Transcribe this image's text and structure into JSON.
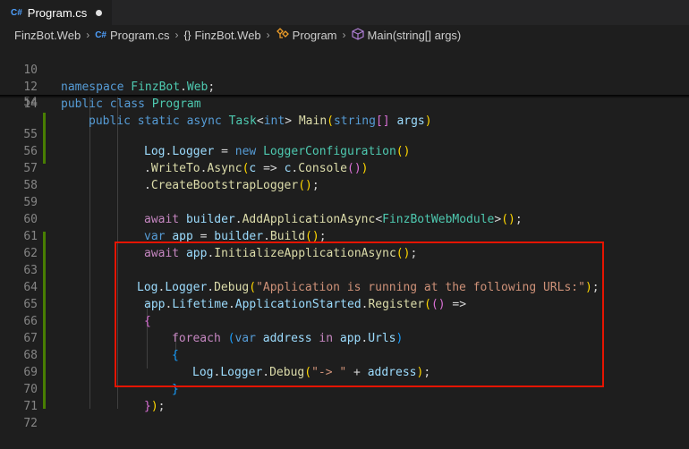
{
  "tab": {
    "badge": "C#",
    "label": "Program.cs"
  },
  "breadcrumb": {
    "project": "FinzBot.Web",
    "file_badge": "C#",
    "file": "Program.cs",
    "ns_icon": "{}",
    "namespace": "FinzBot.Web",
    "class": "Program",
    "method": "Main(string[] args)"
  },
  "icons": {
    "class_icon": "class-symbol-icon",
    "method_icon": "method-cube-icon",
    "chevron": "›"
  },
  "lines": {
    "l10": {
      "n": "10",
      "a": "namespace",
      "b": " FinzBot",
      "c": ".",
      "d": "Web",
      "e": ";"
    },
    "l12": {
      "n": "12",
      "a": "public",
      "b": " ",
      "c": "class",
      "d": " ",
      "e": "Program"
    },
    "l14": {
      "n": "14",
      "a": "public",
      "b": " ",
      "c": "static",
      "d": " ",
      "e": "async",
      "f": " ",
      "g": "Task",
      "h": "<",
      "i": "int",
      "j": ">",
      "k": " ",
      "l": "Main",
      "m": "(",
      "o": "string",
      "p": "[]",
      "q": " ",
      "r": "args",
      "s": ")"
    },
    "l54": {
      "n": "54"
    },
    "l55": {
      "n": "55",
      "a": "Log",
      "b": ".",
      "c": "Logger",
      "d": " = ",
      "e": "new",
      "f": " ",
      "g": "LoggerConfiguration",
      "h": "()"
    },
    "l56": {
      "n": "56",
      "a": ".",
      "b": "WriteTo",
      "c": ".",
      "d": "Async",
      "e": "(",
      "f": "c",
      "g": " => ",
      "h": "c",
      "i": ".",
      "j": "Console",
      "k": "()",
      "l": ")"
    },
    "l57": {
      "n": "57",
      "a": ".",
      "b": "CreateBootstrapLogger",
      "c": "()",
      "d": ";"
    },
    "l58": {
      "n": "58"
    },
    "l59": {
      "n": "59",
      "a": "await",
      "b": " ",
      "c": "builder",
      "d": ".",
      "e": "AddApplicationAsync",
      "f": "<",
      "g": "FinzBotWebModule",
      "h": ">",
      "i": "()",
      "j": ";"
    },
    "l60": {
      "n": "60",
      "a": "var",
      "b": " ",
      "c": "app",
      "d": " = ",
      "e": "builder",
      "f": ".",
      "g": "Build",
      "h": "()",
      "i": ";"
    },
    "l61": {
      "n": "61",
      "a": "await",
      "b": " ",
      "c": "app",
      "d": ".",
      "e": "InitializeApplicationAsync",
      "f": "()",
      "g": ";"
    },
    "l62": {
      "n": "62"
    },
    "l63": {
      "n": "63",
      "a": "Log",
      "b": ".",
      "c": "Logger",
      "d": ".",
      "e": "Debug",
      "f": "(",
      "g": "\"Application is running at the following URLs:\"",
      "h": ")",
      "i": ";"
    },
    "l64": {
      "n": "64",
      "a": "app",
      "b": ".",
      "c": "Lifetime",
      "d": ".",
      "e": "ApplicationStarted",
      "f": ".",
      "g": "Register",
      "h": "(",
      "i": "()",
      "j": " =>"
    },
    "l65": {
      "n": "65",
      "a": "{"
    },
    "l66": {
      "n": "66",
      "a": "foreach",
      "b": " (",
      "c": "var",
      "d": " ",
      "e": "address",
      "f": " ",
      "g": "in",
      "h": " ",
      "i": "app",
      "j": ".",
      "k": "Urls",
      "l": ")"
    },
    "l67": {
      "n": "67",
      "a": "{"
    },
    "l68": {
      "n": "68",
      "a": "Log",
      "b": ".",
      "c": "Logger",
      "d": ".",
      "e": "Debug",
      "f": "(",
      "g": "\"-> \"",
      "h": " + ",
      "i": "address",
      "j": ")",
      "k": ";"
    },
    "l69": {
      "n": "69",
      "a": "}"
    },
    "l70": {
      "n": "70",
      "a": "}",
      "b": ")",
      "c": ";"
    },
    "l71": {
      "n": "71"
    },
    "l72": {
      "n": "72"
    }
  }
}
